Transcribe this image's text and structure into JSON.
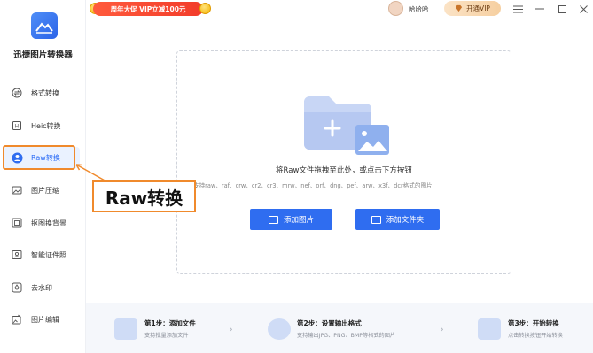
{
  "app": {
    "name": "迅捷图片转换器"
  },
  "sidebar": {
    "items": [
      {
        "label": "格式转换",
        "icon": "format-convert-icon"
      },
      {
        "label": "Heic转换",
        "icon": "heic-icon"
      },
      {
        "label": "Raw转换",
        "icon": "raw-icon",
        "active": true
      },
      {
        "label": "图片压缩",
        "icon": "compress-icon"
      },
      {
        "label": "抠图换背景",
        "icon": "cutout-icon"
      },
      {
        "label": "智能证件照",
        "icon": "id-photo-icon"
      },
      {
        "label": "去水印",
        "icon": "watermark-icon"
      },
      {
        "label": "图片编辑",
        "icon": "edit-icon"
      }
    ]
  },
  "topbar": {
    "promo": "周年大促 VIP立减100元",
    "username": "哈哈哈",
    "vip_label": "开通VIP"
  },
  "dropzone": {
    "title": "将Raw文件拖拽至此处，或点击下方按钮",
    "subtitle": "支持raw、raf、crw、cr2、cr3、mrw、nef、orf、dng、pef、arw、x3f、dcr格式的图片",
    "add_image": "添加图片",
    "add_folder": "添加文件夹"
  },
  "callout": {
    "text": "Raw转换"
  },
  "steps": [
    {
      "title": "第1步：添加文件",
      "desc": "支持批量添加文件"
    },
    {
      "title": "第2步：设置输出格式",
      "desc": "支持输出JPG、PNG、BMP等格式的图片"
    },
    {
      "title": "第3步：开始转换",
      "desc": "点击转换按钮开始转换"
    }
  ],
  "colors": {
    "accent": "#2f6df0",
    "highlight": "#f08a2c",
    "promo": "#f23c2a"
  }
}
